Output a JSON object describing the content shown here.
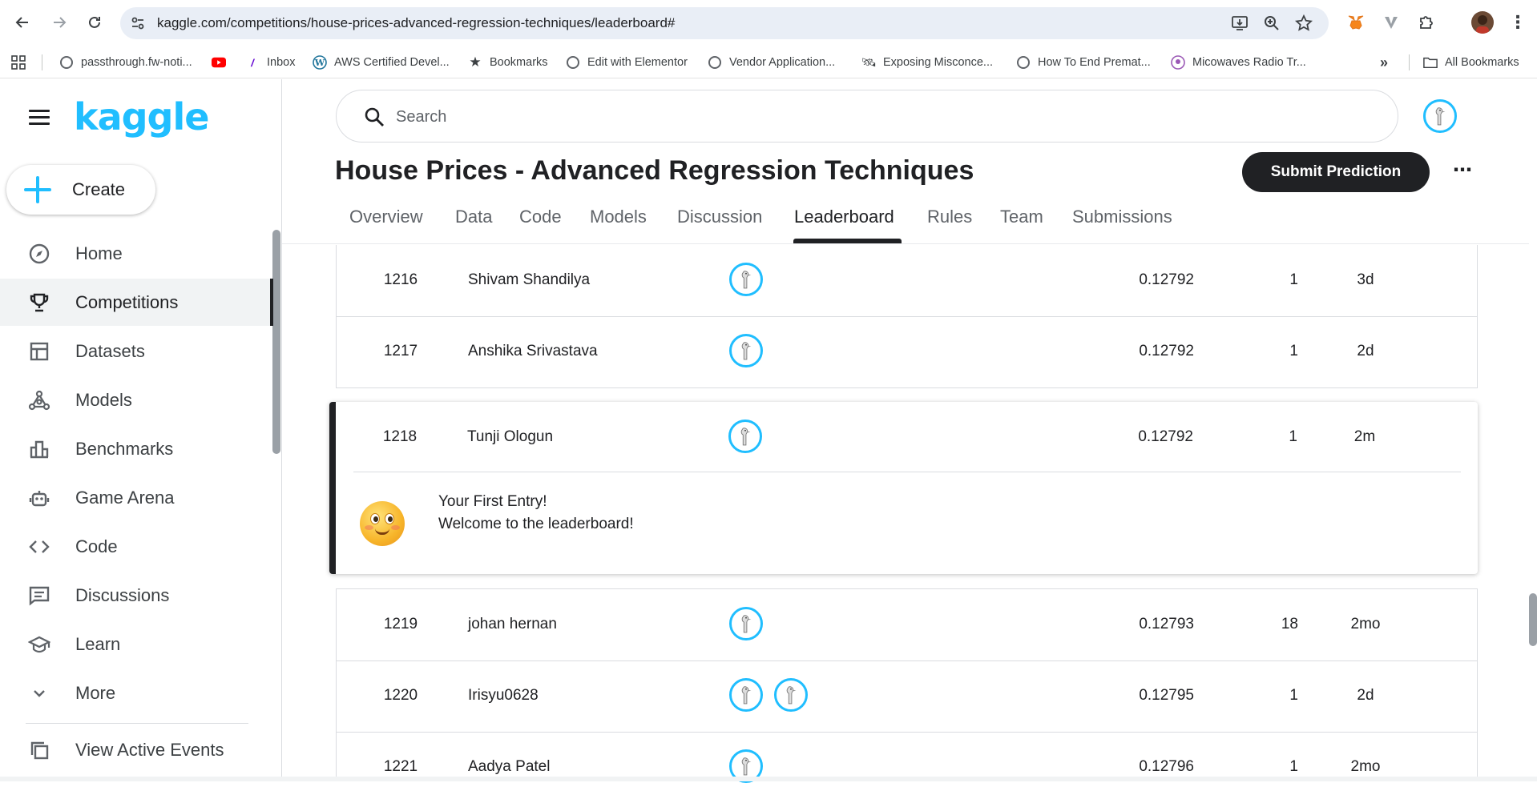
{
  "browser": {
    "url": "kaggle.com/competitions/house-prices-advanced-regression-techniques/leaderboard#",
    "bookmarks": [
      "passthrough.fw-noti...",
      "",
      "Inbox",
      "AWS Certified Devel...",
      "Bookmarks",
      "Edit with Elementor",
      "Vendor Application...",
      "Exposing Misconce...",
      "How To End Premat...",
      "Micowaves Radio Tr..."
    ],
    "all_bookmarks": "All Bookmarks",
    "overflow": "»"
  },
  "sidebar": {
    "logo": "kaggle",
    "create_label": "Create",
    "items": [
      {
        "label": "Home",
        "icon": "compass-icon"
      },
      {
        "label": "Competitions",
        "icon": "trophy-icon"
      },
      {
        "label": "Datasets",
        "icon": "table-icon"
      },
      {
        "label": "Models",
        "icon": "models-icon"
      },
      {
        "label": "Benchmarks",
        "icon": "bar-chart-icon"
      },
      {
        "label": "Game Arena",
        "icon": "robot-icon"
      },
      {
        "label": "Code",
        "icon": "code-icon"
      },
      {
        "label": "Discussions",
        "icon": "discussion-icon"
      },
      {
        "label": "Learn",
        "icon": "school-icon"
      },
      {
        "label": "More",
        "icon": "chevron-down-icon"
      }
    ],
    "active_item": "Competitions",
    "view_active_events": "View Active Events"
  },
  "search": {
    "placeholder": "Search"
  },
  "competition": {
    "title": "House Prices - Advanced Regression Techniques",
    "submit_label": "Submit Prediction",
    "more_label": "⋯",
    "tabs": [
      "Overview",
      "Data",
      "Code",
      "Models",
      "Discussion",
      "Leaderboard",
      "Rules",
      "Team",
      "Submissions"
    ],
    "active_tab": "Leaderboard"
  },
  "leaderboard": {
    "rows_above": [
      {
        "rank": "1216",
        "name": "Shivam Shandilya",
        "score": "0.12792",
        "entries": "1",
        "last": "3d",
        "avatars": 1
      },
      {
        "rank": "1217",
        "name": "Anshika Srivastava",
        "score": "0.12792",
        "entries": "1",
        "last": "2d",
        "avatars": 1
      }
    ],
    "highlighted": {
      "rank": "1218",
      "name": "Tunji Ologun",
      "score": "0.12792",
      "entries": "1",
      "last": "2m",
      "avatars": 1,
      "message_title": "Your First Entry!",
      "message_body": "Welcome to the leaderboard!"
    },
    "rows_below": [
      {
        "rank": "1219",
        "name": "johan hernan",
        "score": "0.12793",
        "entries": "18",
        "last": "2mo",
        "avatars": 1
      },
      {
        "rank": "1220",
        "name": "Irisyu0628",
        "score": "0.12795",
        "entries": "1",
        "last": "2d",
        "avatars": 2
      },
      {
        "rank": "1221",
        "name": "Aadya Patel",
        "score": "0.12796",
        "entries": "1",
        "last": "2mo",
        "avatars": 1
      }
    ]
  },
  "colors": {
    "brand": "#20beff",
    "dark": "#202124",
    "border": "#dadce0"
  }
}
